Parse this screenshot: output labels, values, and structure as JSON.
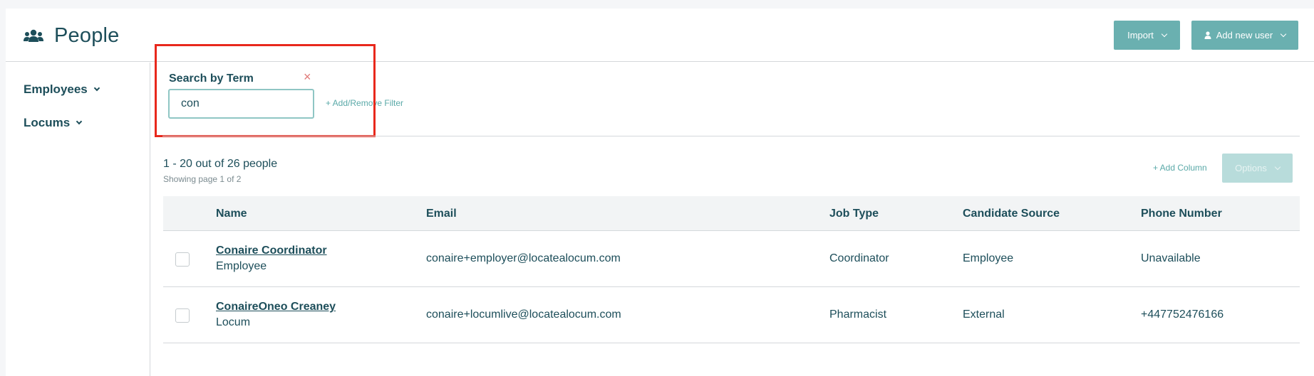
{
  "header": {
    "title": "People",
    "icon": "people-icon",
    "import_label": "Import",
    "add_user_label": "Add new user"
  },
  "sidebar": {
    "items": [
      {
        "label": "Employees"
      },
      {
        "label": "Locums"
      }
    ]
  },
  "filter": {
    "label": "Search by Term",
    "close_symbol": "×",
    "value": "con",
    "add_filter_label": "+ Add/Remove Filter"
  },
  "results": {
    "count_text": "1 - 20 out of 26 people",
    "page_text": "Showing page 1 of 2",
    "add_column_label": "+ Add Column",
    "options_label": "Options"
  },
  "table": {
    "headers": {
      "name": "Name",
      "email": "Email",
      "job_type": "Job Type",
      "candidate_source": "Candidate Source",
      "phone": "Phone Number"
    },
    "rows": [
      {
        "name": "Conaire Coordinator",
        "role": "Employee",
        "email": "conaire+employer@locatealocum.com",
        "job_type": "Coordinator",
        "candidate_source": "Employee",
        "phone": "Unavailable"
      },
      {
        "name": "ConaireOneo Creaney",
        "role": "Locum",
        "email": "conaire+locumlive@locatealocum.com",
        "job_type": "Pharmacist",
        "candidate_source": "External",
        "phone": "+447752476166"
      }
    ]
  },
  "colors": {
    "accent": "#6ab0b0",
    "text": "#1d4e5a",
    "highlight": "#e8281c",
    "close": "#e07a78"
  }
}
